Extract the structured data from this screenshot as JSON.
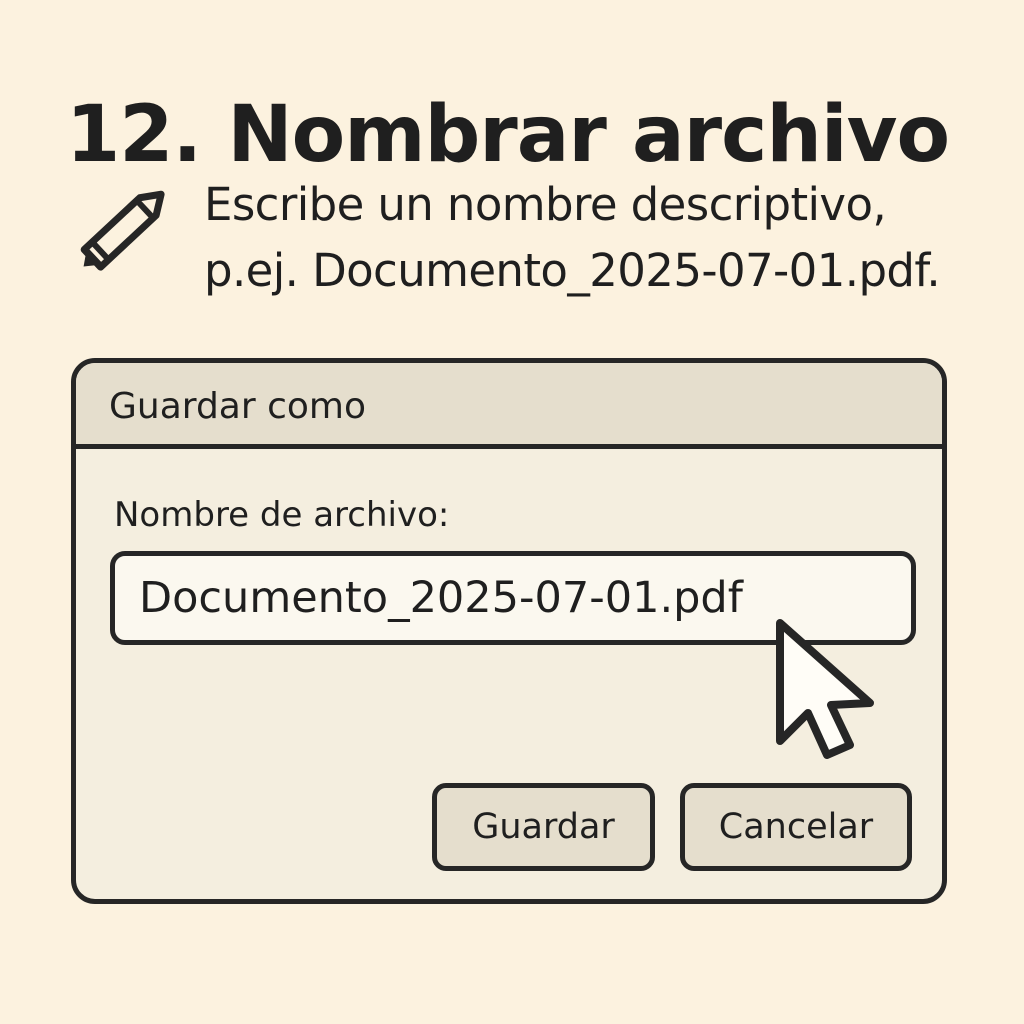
{
  "step": {
    "title": "12. Nombrar archivo",
    "instruction_line_1": "Escribe un nombre descriptivo,",
    "instruction_line_2": "p.ej. Documento_2025-07-01.pdf."
  },
  "dialog": {
    "title": "Guardar como",
    "field_label": "Nombre de archivo:",
    "filename_value": "Documento_2025-07-01.pdf",
    "buttons": {
      "save": "Guardar",
      "cancel": "Cancelar"
    }
  },
  "icons": {
    "instruction": "pencil-icon",
    "pointer": "mouse-pointer-icon"
  },
  "colors": {
    "background": "#fcf2df",
    "dialog": "#f4eedf",
    "header": "#e5decd",
    "input": "#fbf8ef",
    "stroke": "#262626",
    "text": "#1f1f1f"
  }
}
